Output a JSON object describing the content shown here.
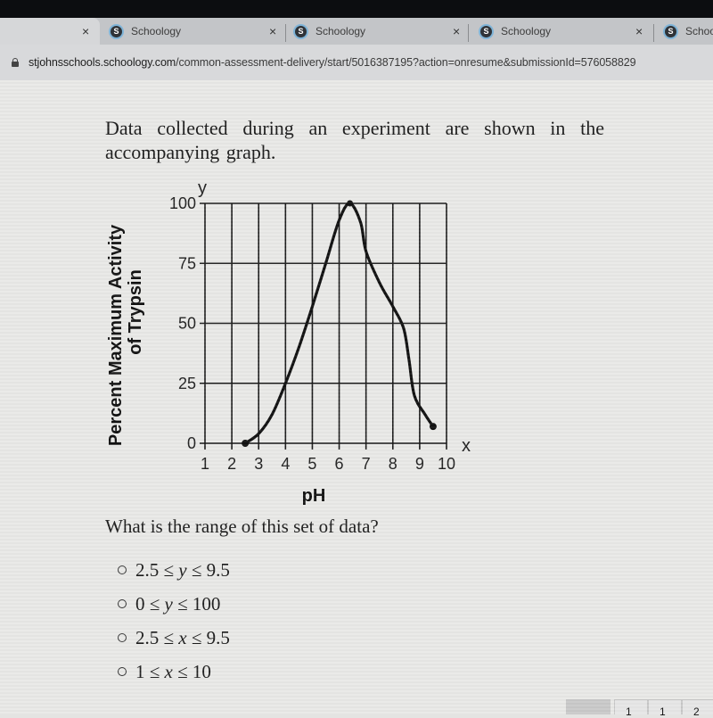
{
  "browser": {
    "tabs": [
      {
        "title": "",
        "icon": "blank",
        "close": "×"
      },
      {
        "title": "Schoology",
        "icon": "schoology-logo",
        "favicon_letter": "S",
        "close": "×"
      },
      {
        "title": "Schoology",
        "icon": "schoology-logo",
        "favicon_letter": "S",
        "close": "×"
      },
      {
        "title": "Schoology",
        "icon": "schoology-logo",
        "favicon_letter": "S",
        "close": "×"
      },
      {
        "title": "Schoo",
        "icon": "schoology-logo",
        "favicon_letter": "S"
      }
    ],
    "address_bar": {
      "icon": "lock-icon",
      "host": "stjohnsschools.schoology.com",
      "path": "/common-assessment-delivery/start/5016387195?action=onresume&submissionId=576058829"
    }
  },
  "question": {
    "intro": "Data collected during an experiment are shown in the accompanying graph.",
    "prompt": "What is the range of this set of data?",
    "choices": [
      {
        "parts": [
          "2.5 ≤ ",
          "y",
          " ≤ 9.5"
        ]
      },
      {
        "parts": [
          "0 ≤ ",
          "y",
          " ≤ 100"
        ]
      },
      {
        "parts": [
          "2.5 ≤ ",
          "x",
          " ≤ 9.5"
        ]
      },
      {
        "parts": [
          "1 ≤ ",
          "x",
          " ≤ 10"
        ]
      }
    ]
  },
  "pager": {
    "visible_labels": [
      "",
      "1",
      "1",
      "2"
    ]
  },
  "chart_data": {
    "type": "line",
    "title": "",
    "xlabel": "pH",
    "ylabel": "Percent Maximum Activity of Trypsin",
    "ylabel_lines": [
      "Percent Maximum Activity",
      "of Trypsin"
    ],
    "x_axis_letter": "x",
    "y_axis_letter": "y",
    "xlim": [
      1,
      10
    ],
    "ylim": [
      0,
      100
    ],
    "x_ticks": [
      1,
      2,
      3,
      4,
      5,
      6,
      7,
      8,
      9,
      10
    ],
    "y_ticks": [
      0,
      25,
      50,
      75,
      100
    ],
    "grid": true,
    "series": [
      {
        "name": "Trypsin activity",
        "x": [
          2.5,
          3,
          3.5,
          4,
          4.5,
          5,
          5.5,
          6,
          6.4,
          6.8,
          7,
          7.5,
          8,
          8.4,
          8.6,
          8.8,
          9.2,
          9.5
        ],
        "y": [
          0,
          4,
          12,
          25,
          40,
          57,
          75,
          93,
          100,
          92,
          80,
          67,
          57,
          48,
          35,
          20,
          12,
          7
        ],
        "endpoints_marked": true
      }
    ]
  }
}
